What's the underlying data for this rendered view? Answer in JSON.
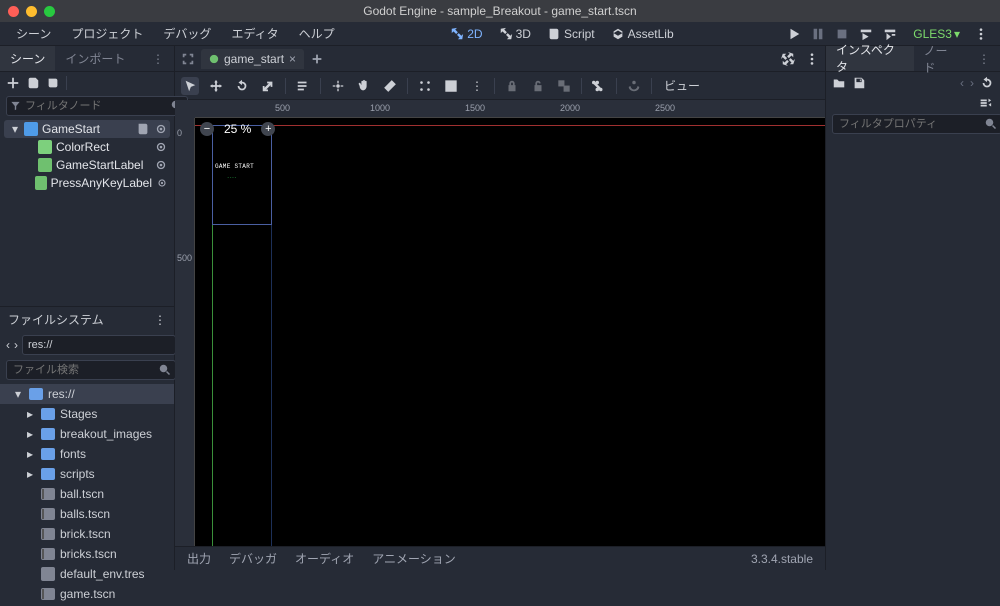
{
  "title": "Godot Engine - sample_Breakout - game_start.tscn",
  "menu": [
    "シーン",
    "プロジェクト",
    "デバッグ",
    "エディタ",
    "ヘルプ"
  ],
  "workspace": {
    "d2": "2D",
    "d3": "3D",
    "script": "Script",
    "assetlib": "AssetLib"
  },
  "renderer": "GLES3",
  "scene_dock": {
    "tab_scene": "シーン",
    "tab_import": "インポート",
    "filter_placeholder": "フィルタノード",
    "nodes": [
      {
        "name": "GameStart",
        "icon": "control",
        "sel": true,
        "script": true
      },
      {
        "name": "ColorRect",
        "icon": "colorrect",
        "ind": 1
      },
      {
        "name": "GameStartLabel",
        "icon": "label",
        "ind": 1
      },
      {
        "name": "PressAnyKeyLabel",
        "icon": "label",
        "ind": 1
      }
    ]
  },
  "fs_dock": {
    "title": "ファイルシステム",
    "path": "res://",
    "search_placeholder": "ファイル検索",
    "items": [
      {
        "name": "res://",
        "type": "folder",
        "sel": true,
        "tog": "▾"
      },
      {
        "name": "Stages",
        "type": "folder",
        "ind": 1,
        "tog": "▸"
      },
      {
        "name": "breakout_images",
        "type": "folder",
        "ind": 1,
        "tog": "▸"
      },
      {
        "name": "fonts",
        "type": "folder",
        "ind": 1,
        "tog": "▸"
      },
      {
        "name": "scripts",
        "type": "folder",
        "ind": 1,
        "tog": "▸"
      },
      {
        "name": "ball.tscn",
        "type": "scene",
        "ind": 1
      },
      {
        "name": "balls.tscn",
        "type": "scene",
        "ind": 1
      },
      {
        "name": "brick.tscn",
        "type": "scene",
        "ind": 1
      },
      {
        "name": "bricks.tscn",
        "type": "scene",
        "ind": 1
      },
      {
        "name": "default_env.tres",
        "type": "tres",
        "ind": 1
      },
      {
        "name": "game.tscn",
        "type": "scene",
        "ind": 1
      }
    ]
  },
  "scene_tab": {
    "name": "game_start"
  },
  "viewport": {
    "zoom": "25 %",
    "view_label": "ビュー",
    "ruler_h": [
      "500",
      "1000",
      "1500",
      "2000",
      "2500"
    ],
    "ruler_v": [
      "0",
      "500"
    ],
    "label1": "GAME START",
    "label2": "----"
  },
  "inspector": {
    "tab_inspector": "インスペクタ",
    "tab_node": "ノード",
    "filter_placeholder": "フィルタプロパティ"
  },
  "bottom": {
    "output": "出力",
    "debugger": "デバッガ",
    "audio": "オーディオ",
    "anim": "アニメーション",
    "version": "3.3.4.stable"
  }
}
